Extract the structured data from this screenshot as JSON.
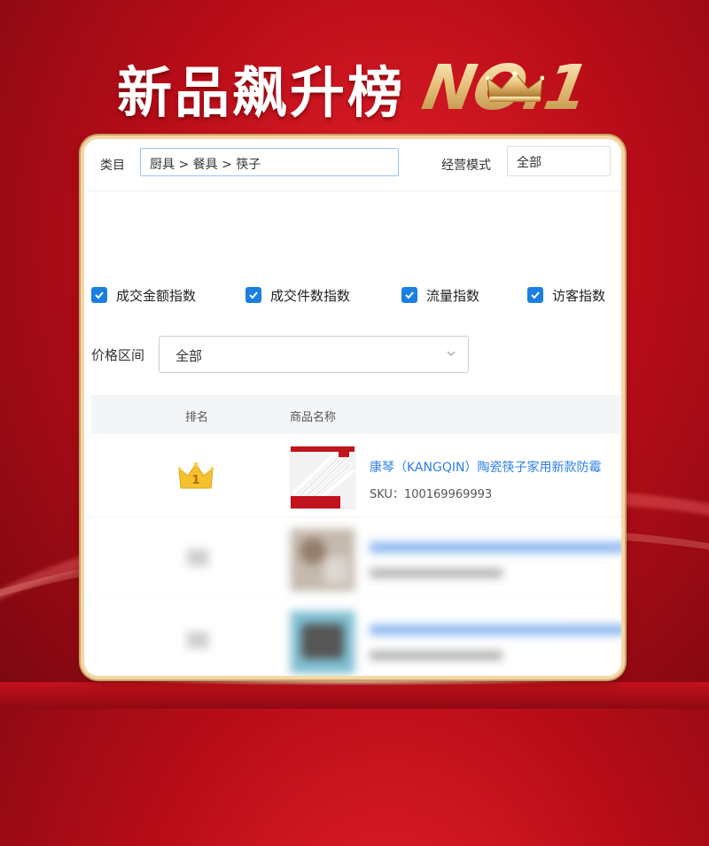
{
  "banner": {
    "title": "新品飙升榜",
    "rank_badge": "NO.1"
  },
  "filters": {
    "category_label": "类目",
    "category_value": "厨具 > 餐具 > 筷子",
    "mode_label": "经营模式",
    "mode_value": "全部",
    "checkboxes": [
      {
        "label": "成交金额指数",
        "checked": true
      },
      {
        "label": "成交件数指数",
        "checked": true
      },
      {
        "label": "流量指数",
        "checked": true
      },
      {
        "label": "访客指数",
        "checked": true
      }
    ],
    "price_label": "价格区间",
    "price_value": "全部"
  },
  "table": {
    "headers": {
      "rank": "排名",
      "product": "商品名称"
    },
    "rows": [
      {
        "rank": "1",
        "name": "康琴（KANGQIN）陶瓷筷子家用新款防霉",
        "sku": "SKU：100169969993"
      }
    ]
  },
  "colors": {
    "accent": "#1a7fe0",
    "link": "#2d7fe3",
    "background": "#c5111c",
    "gold": "#e8c27c"
  }
}
